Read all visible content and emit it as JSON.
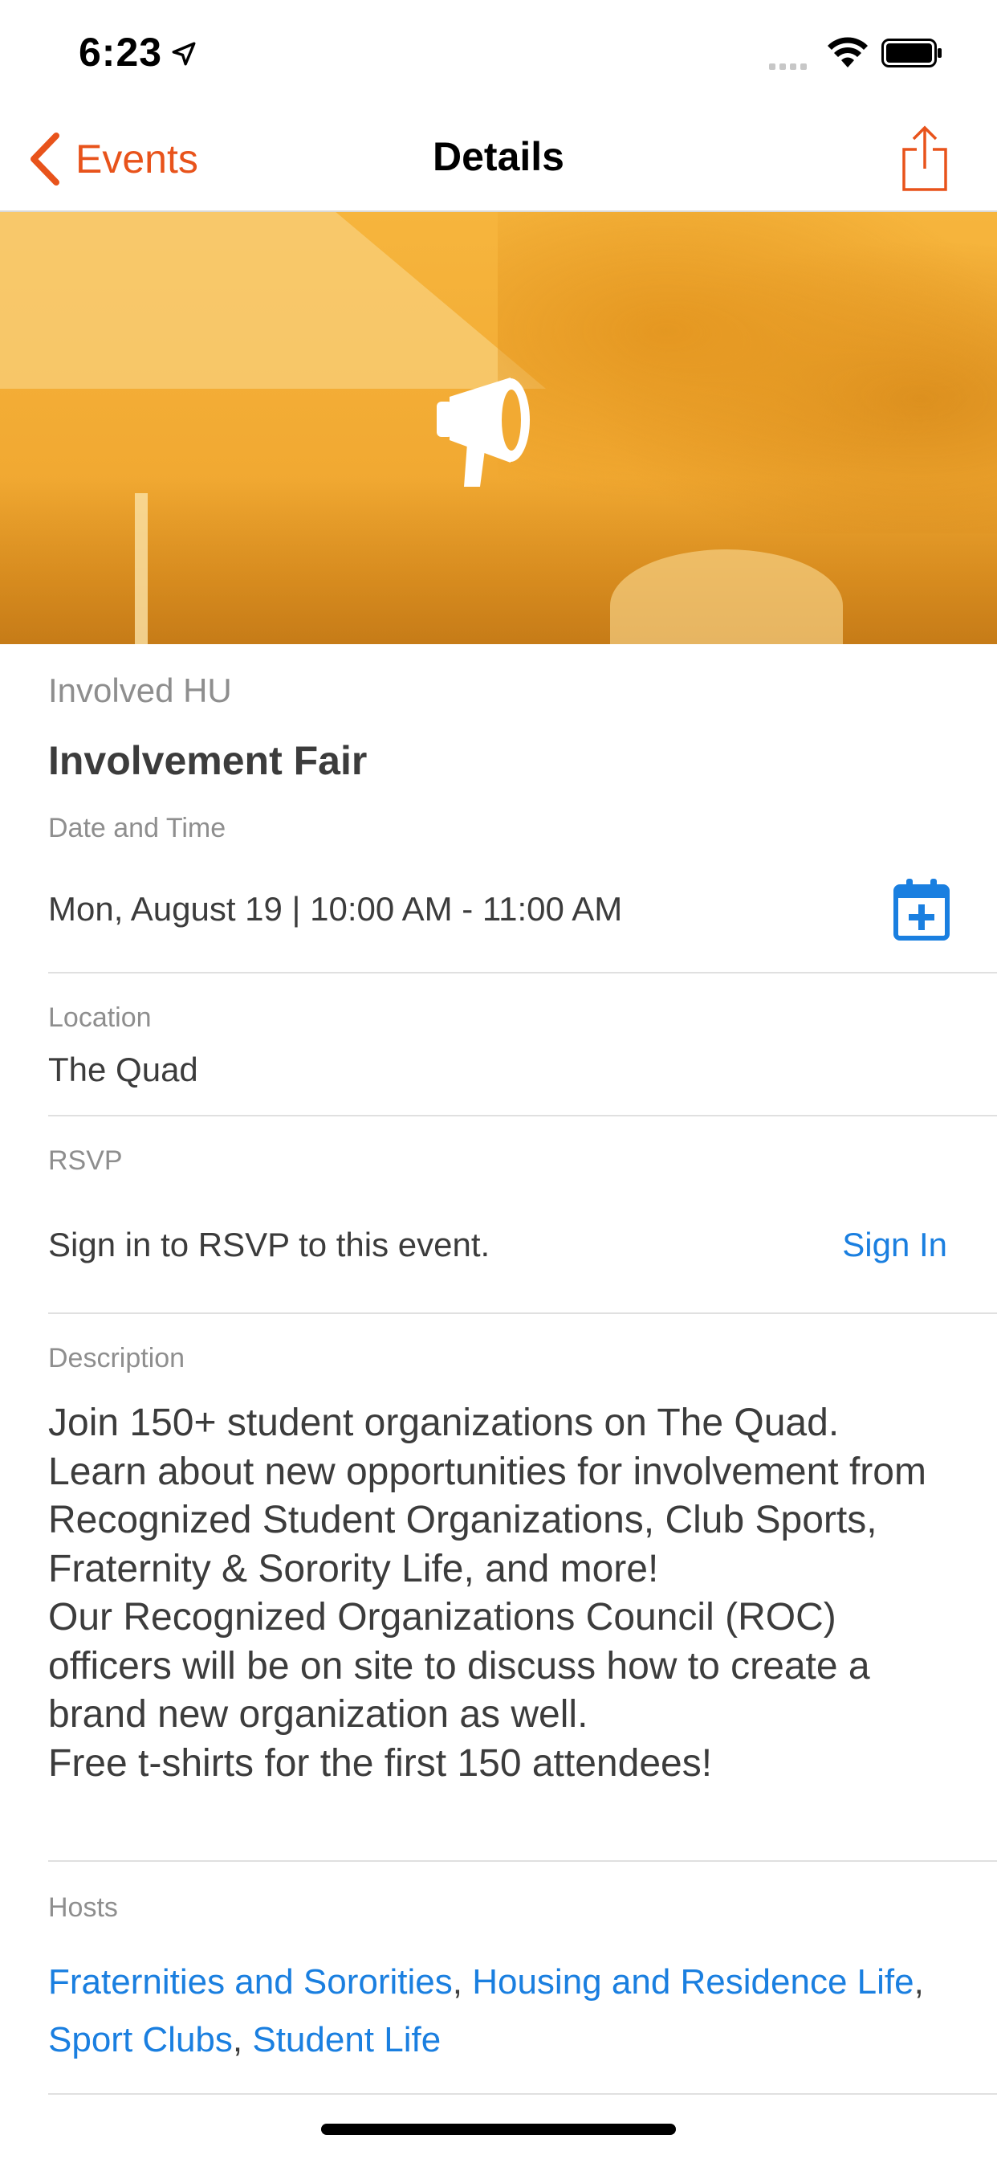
{
  "status": {
    "time": "6:23"
  },
  "nav": {
    "back_label": "Events",
    "title": "Details"
  },
  "event": {
    "organization": "Involved HU",
    "title": "Involvement Fair",
    "datetime_label": "Date and Time",
    "datetime": "Mon, August 19 | 10:00 AM - 11:00 AM",
    "location_label": "Location",
    "location": "The Quad",
    "rsvp_label": "RSVP",
    "rsvp_text": "Sign in to RSVP to this event.",
    "rsvp_action": "Sign In",
    "description_label": "Description",
    "description": "Join 150+ student organizations on The Quad.\nLearn about new opportunities for involvement from Recognized Student Organizations, Club Sports, Fraternity & Sorority Life, and more!\nOur Recognized Organizations Council (ROC) officers will be on site to discuss how to create a brand new organization as well.\nFree t-shirts for the first 150 attendees!",
    "hosts_label": "Hosts",
    "hosts": [
      "Fraternities and Sororities",
      "Housing and Residence Life",
      "Sport Clubs",
      "Student Life"
    ],
    "hosts_separator": ", "
  },
  "icons": {
    "back": "chevron-left-icon",
    "share": "share-icon",
    "hero": "megaphone-icon",
    "calendar": "calendar-add-icon"
  },
  "colors": {
    "accent": "#e8531b",
    "link": "#1a7fe0",
    "hero_overlay": "#f5b03a"
  }
}
